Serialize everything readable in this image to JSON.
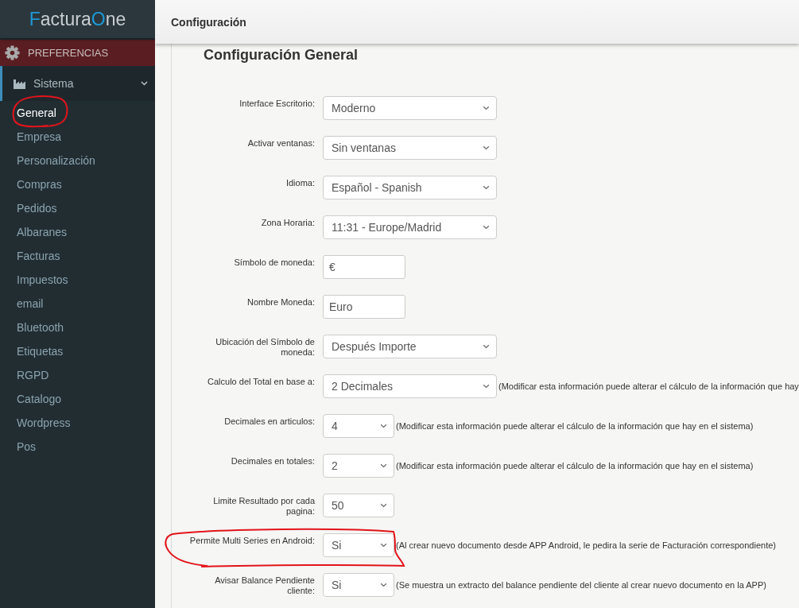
{
  "sidebar": {
    "logo": [
      {
        "text": "F",
        "accent": true
      },
      {
        "text": "actura",
        "accent": false
      },
      {
        "text": "O",
        "accent": true
      },
      {
        "text": "ne",
        "accent": false
      }
    ],
    "section": "PREFERENCIAS",
    "menu": {
      "label": "Sistema",
      "selected": true,
      "expanded": true,
      "children": [
        {
          "label": "General",
          "selected": true,
          "circled": true
        },
        {
          "label": "Empresa",
          "selected": false,
          "circled": false
        },
        {
          "label": "Personalización",
          "selected": false,
          "circled": false
        },
        {
          "label": "Compras",
          "selected": false,
          "circled": false
        },
        {
          "label": "Pedidos",
          "selected": false,
          "circled": false
        },
        {
          "label": "Albaranes",
          "selected": false,
          "circled": false
        },
        {
          "label": "Facturas",
          "selected": false,
          "circled": false
        },
        {
          "label": "Impuestos",
          "selected": false,
          "circled": false
        },
        {
          "label": "email",
          "selected": false,
          "circled": false
        },
        {
          "label": "Bluetooth",
          "selected": false,
          "circled": false
        },
        {
          "label": "Etiquetas",
          "selected": false,
          "circled": false
        },
        {
          "label": "RGPD",
          "selected": false,
          "circled": false
        },
        {
          "label": "Catalogo",
          "selected": false,
          "circled": false
        },
        {
          "label": "Wordpress",
          "selected": false,
          "circled": false
        },
        {
          "label": "Pos",
          "selected": false,
          "circled": false
        }
      ]
    }
  },
  "header": {
    "title": "Configuración"
  },
  "form": {
    "title": "Configuración General",
    "fields": [
      {
        "label": "Interface Escritorio:",
        "kind": "select",
        "value": "Moderno",
        "circled": false
      },
      {
        "label": "Activar ventanas:",
        "kind": "select",
        "value": "Sin ventanas",
        "circled": false
      },
      {
        "label": "Idioma:",
        "kind": "select",
        "value": "Español - Spanish",
        "circled": false
      },
      {
        "label": "Zona Horaria:",
        "kind": "select",
        "value": "11:31 - Europe/Madrid",
        "circled": false
      },
      {
        "label": "Símbolo de moneda:",
        "kind": "text",
        "value": "€",
        "circled": false
      },
      {
        "label": "Nombre Moneda:",
        "kind": "text",
        "value": "Euro",
        "circled": false
      },
      {
        "label": "Ubicación del Símbolo de moneda:",
        "kind": "select",
        "value": "Después Importe",
        "circled": false
      },
      {
        "label": "Calculo del Total en base a:",
        "kind": "select",
        "value": "2 Decimales",
        "note": "(Modificar esta información puede alterar el cálculo de la información que hay",
        "circled": false
      },
      {
        "label": "Decimales en articulos:",
        "kind": "compact-select",
        "value": "4",
        "note": "(Modificar esta información puede alterar el cálculo de la información que hay en el sistema)",
        "circled": false
      },
      {
        "label": "Decimales en totales:",
        "kind": "compact-select",
        "value": "2",
        "note": "(Modificar esta información puede alterar el cálculo de la información que hay en el sistema)",
        "circled": false
      },
      {
        "label": "Limite Resultado por cada pagina:",
        "kind": "compact-select",
        "value": "50",
        "circled": false
      },
      {
        "label": "Permite Multi Series en Android:",
        "kind": "compact-select",
        "value": "Si",
        "note": "(Al crear nuevo documento desde APP Android, le pedira la serie de Facturación correspondiente)",
        "circled": true
      },
      {
        "label": "Avisar Balance Pendiente cliente:",
        "kind": "compact-select",
        "value": "Si",
        "note": "(Se muestra un extracto del balance pendiente del cliente al crear nuevo documento en la APP)",
        "circled": false
      }
    ]
  }
}
